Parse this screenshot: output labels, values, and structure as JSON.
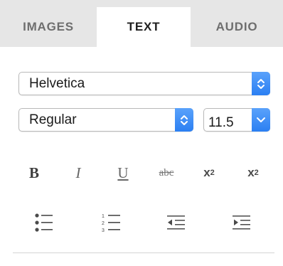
{
  "tabs": [
    {
      "label": "IMAGES",
      "active": false
    },
    {
      "label": "TEXT",
      "active": true
    },
    {
      "label": "AUDIO",
      "active": false
    }
  ],
  "font": {
    "family": "Helvetica",
    "style": "Regular",
    "size": "11.5"
  },
  "format_buttons": {
    "bold": "B",
    "italic": "I",
    "underline": "U",
    "strikethrough": "abc",
    "superscript_base": "x",
    "superscript_exp": "2",
    "subscript_base": "x",
    "subscript_idx": "2"
  },
  "list_buttons": {
    "numbered_markers": [
      "1",
      "2",
      "3"
    ],
    "icons": [
      "bulleted-list-icon",
      "numbered-list-icon",
      "decrease-indent-icon",
      "increase-indent-icon"
    ]
  },
  "colors": {
    "accent": "#2b7ff2",
    "tab_bar": "#e6e6e6"
  }
}
